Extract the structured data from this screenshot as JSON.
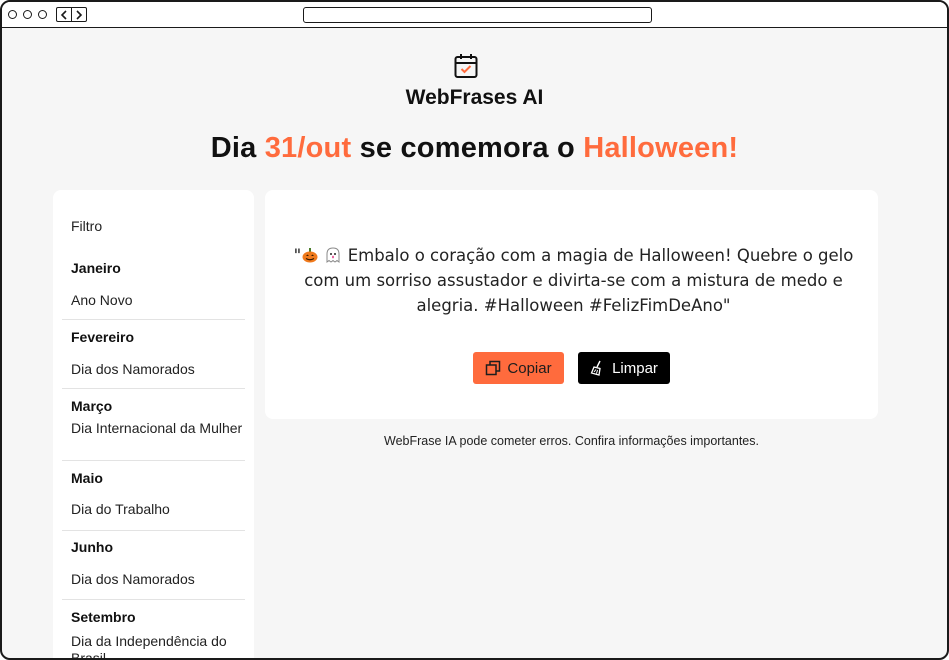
{
  "browser": {
    "controls": [
      "close",
      "minimize",
      "maximize"
    ],
    "nav": {
      "back_icon": "chevron-left",
      "forward_icon": "chevron-right"
    },
    "url": ""
  },
  "header": {
    "logo_icon": "calendar-check-icon",
    "brand": "WebFrases AI",
    "headline_prefix": "Dia ",
    "headline_date": "31/out",
    "headline_middle": " se comemora o ",
    "headline_event": "Halloween!"
  },
  "sidebar": {
    "title": "Filtro",
    "groups": [
      {
        "month": "Janeiro",
        "item": "Ano Novo"
      },
      {
        "month": "Fevereiro",
        "item": "Dia dos Namorados"
      },
      {
        "month": "Março",
        "item": "Dia Internacional da Mulher"
      },
      {
        "month": "Maio",
        "item": "Dia do Trabalho"
      },
      {
        "month": "Junho",
        "item": "Dia dos Namorados"
      },
      {
        "month": "Setembro",
        "item": "Dia da Independência do Brasil"
      }
    ]
  },
  "card": {
    "quote_open": "\"",
    "quote_text": " Embalo o coração com a magia de Halloween! Quebre o gelo com um sorriso assustador e divirta-se com a mistura de medo e alegria. #Halloween #FelizFimDeAno\"",
    "emojis": [
      "pumpkin-icon",
      "ghost-icon"
    ],
    "copy_button": "Copiar",
    "clear_button": "Limpar"
  },
  "footer": {
    "disclaimer": "WebFrase IA pode cometer erros. Confira informações importantes."
  },
  "colors": {
    "accent": "#ff6b3d",
    "background": "#f6f6f6",
    "card": "#ffffff",
    "dark_button": "#000000"
  }
}
